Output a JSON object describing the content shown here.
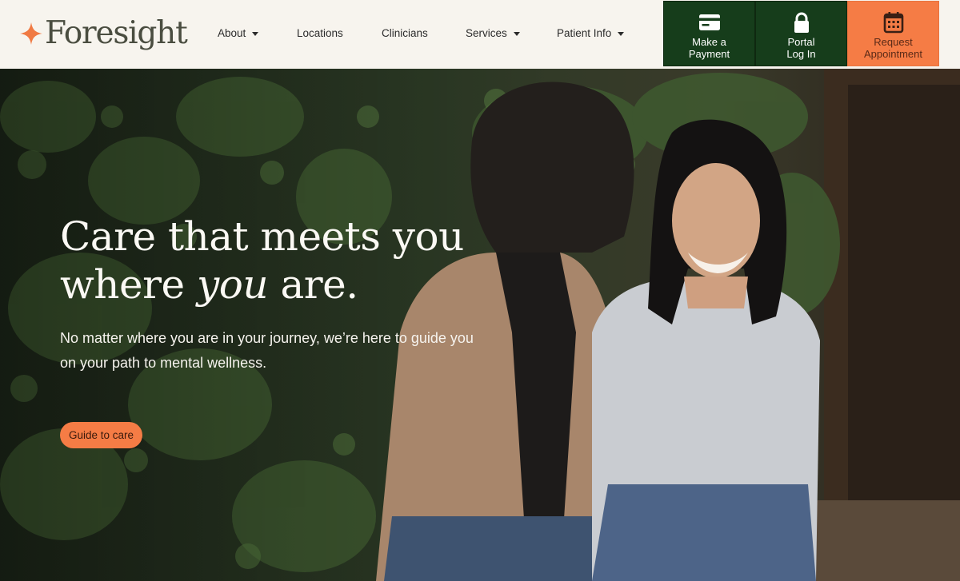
{
  "header": {
    "logo_text": "Foresight",
    "nav": [
      {
        "label": "About",
        "has_dropdown": true
      },
      {
        "label": "Locations",
        "has_dropdown": false
      },
      {
        "label": "Clinicians",
        "has_dropdown": false
      },
      {
        "label": "Services",
        "has_dropdown": true
      },
      {
        "label": "Patient Info",
        "has_dropdown": true
      }
    ],
    "actions": [
      {
        "line1": "Make a",
        "line2": "Payment",
        "icon": "credit-card-icon"
      },
      {
        "line1": "Portal",
        "line2": "Log In",
        "icon": "lock-icon"
      },
      {
        "line1": "Request",
        "line2": "Appointment",
        "icon": "calendar-icon"
      }
    ]
  },
  "hero": {
    "title_line1": "Care that meets you",
    "title_line2_pre": "where ",
    "title_line2_em": "you",
    "title_line2_post": " are.",
    "subtitle": "No matter where you are  in your journey, we’re here to guide you on your path to mental wellness.",
    "button_label": "Guide to care"
  },
  "colors": {
    "header_bg": "#f7f4ee",
    "brand_green": "#163d1b",
    "brand_orange": "#f57c45",
    "text_dark": "#4a4d40"
  }
}
